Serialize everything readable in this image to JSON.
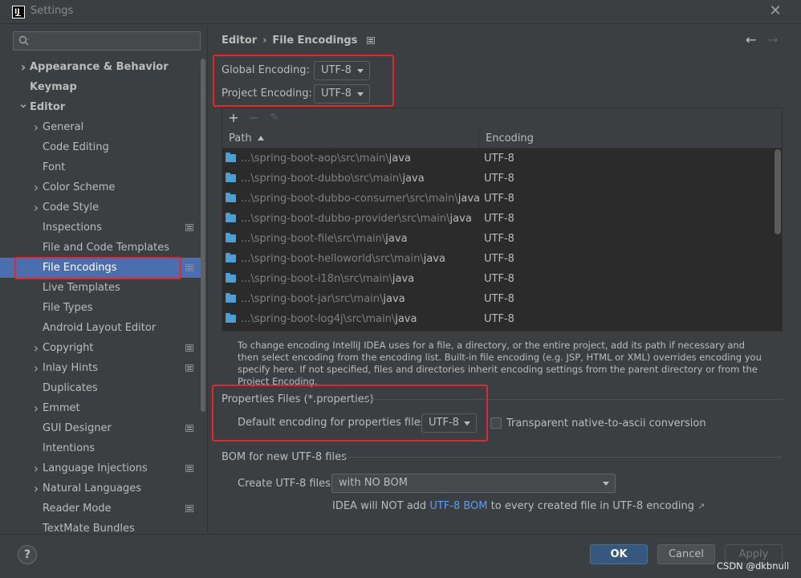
{
  "window": {
    "title": "Settings",
    "app_icon_text": "IJ"
  },
  "search": {
    "placeholder": ""
  },
  "sidebar": {
    "items": [
      {
        "label": "Appearance & Behavior",
        "bold": true,
        "indent": 0,
        "chevron": "right"
      },
      {
        "label": "Keymap",
        "bold": true,
        "indent": 0,
        "chevron": ""
      },
      {
        "label": "Editor",
        "bold": true,
        "indent": 0,
        "chevron": "down"
      },
      {
        "label": "General",
        "indent": 1,
        "chevron": "right"
      },
      {
        "label": "Code Editing",
        "indent": 1,
        "chevron": ""
      },
      {
        "label": "Font",
        "indent": 1,
        "chevron": ""
      },
      {
        "label": "Color Scheme",
        "indent": 1,
        "chevron": "right"
      },
      {
        "label": "Code Style",
        "indent": 1,
        "chevron": "right"
      },
      {
        "label": "Inspections",
        "indent": 1,
        "chevron": "",
        "project_icon": true
      },
      {
        "label": "File and Code Templates",
        "indent": 1,
        "chevron": ""
      },
      {
        "label": "File Encodings",
        "indent": 1,
        "chevron": "",
        "project_icon": true,
        "selected": true
      },
      {
        "label": "Live Templates",
        "indent": 1,
        "chevron": ""
      },
      {
        "label": "File Types",
        "indent": 1,
        "chevron": ""
      },
      {
        "label": "Android Layout Editor",
        "indent": 1,
        "chevron": ""
      },
      {
        "label": "Copyright",
        "indent": 1,
        "chevron": "right",
        "project_icon": true
      },
      {
        "label": "Inlay Hints",
        "indent": 1,
        "chevron": "right",
        "project_icon": true
      },
      {
        "label": "Duplicates",
        "indent": 1,
        "chevron": ""
      },
      {
        "label": "Emmet",
        "indent": 1,
        "chevron": "right"
      },
      {
        "label": "GUI Designer",
        "indent": 1,
        "chevron": "",
        "project_icon": true
      },
      {
        "label": "Intentions",
        "indent": 1,
        "chevron": ""
      },
      {
        "label": "Language Injections",
        "indent": 1,
        "chevron": "right",
        "project_icon": true
      },
      {
        "label": "Natural Languages",
        "indent": 1,
        "chevron": "right"
      },
      {
        "label": "Reader Mode",
        "indent": 1,
        "chevron": "",
        "project_icon": true
      },
      {
        "label": "TextMate Bundles",
        "indent": 1,
        "chevron": ""
      }
    ]
  },
  "breadcrumb": {
    "parent": "Editor",
    "separator": "›",
    "current": "File Encodings"
  },
  "nav": {
    "back": "←",
    "forward": "→"
  },
  "global_encoding": {
    "label": "Global Encoding:",
    "value": "UTF-8"
  },
  "project_encoding": {
    "label": "Project Encoding:",
    "value": "UTF-8"
  },
  "table_toolbar": {
    "add": "+",
    "remove": "−",
    "edit": "✎"
  },
  "table": {
    "headers": {
      "path": "Path",
      "encoding": "Encoding"
    },
    "rows": [
      {
        "prefix": "...\\spring-boot-aop\\src\\main\\",
        "leaf": "java",
        "encoding": "UTF-8"
      },
      {
        "prefix": "...\\spring-boot-dubbo\\src\\main\\",
        "leaf": "java",
        "encoding": "UTF-8"
      },
      {
        "prefix": "...\\spring-boot-dubbo-consumer\\src\\main\\",
        "leaf": "java",
        "encoding": "UTF-8"
      },
      {
        "prefix": "...\\spring-boot-dubbo-provider\\src\\main\\",
        "leaf": "java",
        "encoding": "UTF-8"
      },
      {
        "prefix": "...\\spring-boot-file\\src\\main\\",
        "leaf": "java",
        "encoding": "UTF-8"
      },
      {
        "prefix": "...\\spring-boot-helloworld\\src\\main\\",
        "leaf": "java",
        "encoding": "UTF-8"
      },
      {
        "prefix": "...\\spring-boot-i18n\\src\\main\\",
        "leaf": "java",
        "encoding": "UTF-8"
      },
      {
        "prefix": "...\\spring-boot-jar\\src\\main\\",
        "leaf": "java",
        "encoding": "UTF-8"
      },
      {
        "prefix": "...\\spring-boot-log4j\\src\\main\\",
        "leaf": "java",
        "encoding": "UTF-8"
      }
    ]
  },
  "help_text": "To change encoding IntelliJ IDEA uses for a file, a directory, or the entire project, add its path if necessary and then select encoding from the encoding list. Built-in file encoding (e.g. JSP, HTML or XML) overrides encoding you specify here. If not specified, files and directories inherit encoding settings from the parent directory or from the Project Encoding.",
  "properties": {
    "title": "Properties Files (*.properties)",
    "default_label": "Default encoding for properties files:",
    "default_value": "UTF-8",
    "transparent_label": "Transparent native-to-ascii conversion",
    "transparent_checked": false
  },
  "bom": {
    "title": "BOM for new UTF-8 files",
    "create_label": "Create UTF-8 files:",
    "create_value": "with NO BOM",
    "note_before": "IDEA will NOT add ",
    "note_link": "UTF-8 BOM",
    "note_after": " to every created file in UTF-8 encoding",
    "note_ext": "↗"
  },
  "buttons": {
    "help": "?",
    "ok": "OK",
    "cancel": "Cancel",
    "apply": "Apply"
  },
  "watermark": "CSDN @dkbnull",
  "colors": {
    "selection": "#4b6eaf",
    "primary_button": "#365880",
    "link": "#589df6",
    "folder": "#4a9fd5",
    "highlight_box": "#e8242c"
  }
}
